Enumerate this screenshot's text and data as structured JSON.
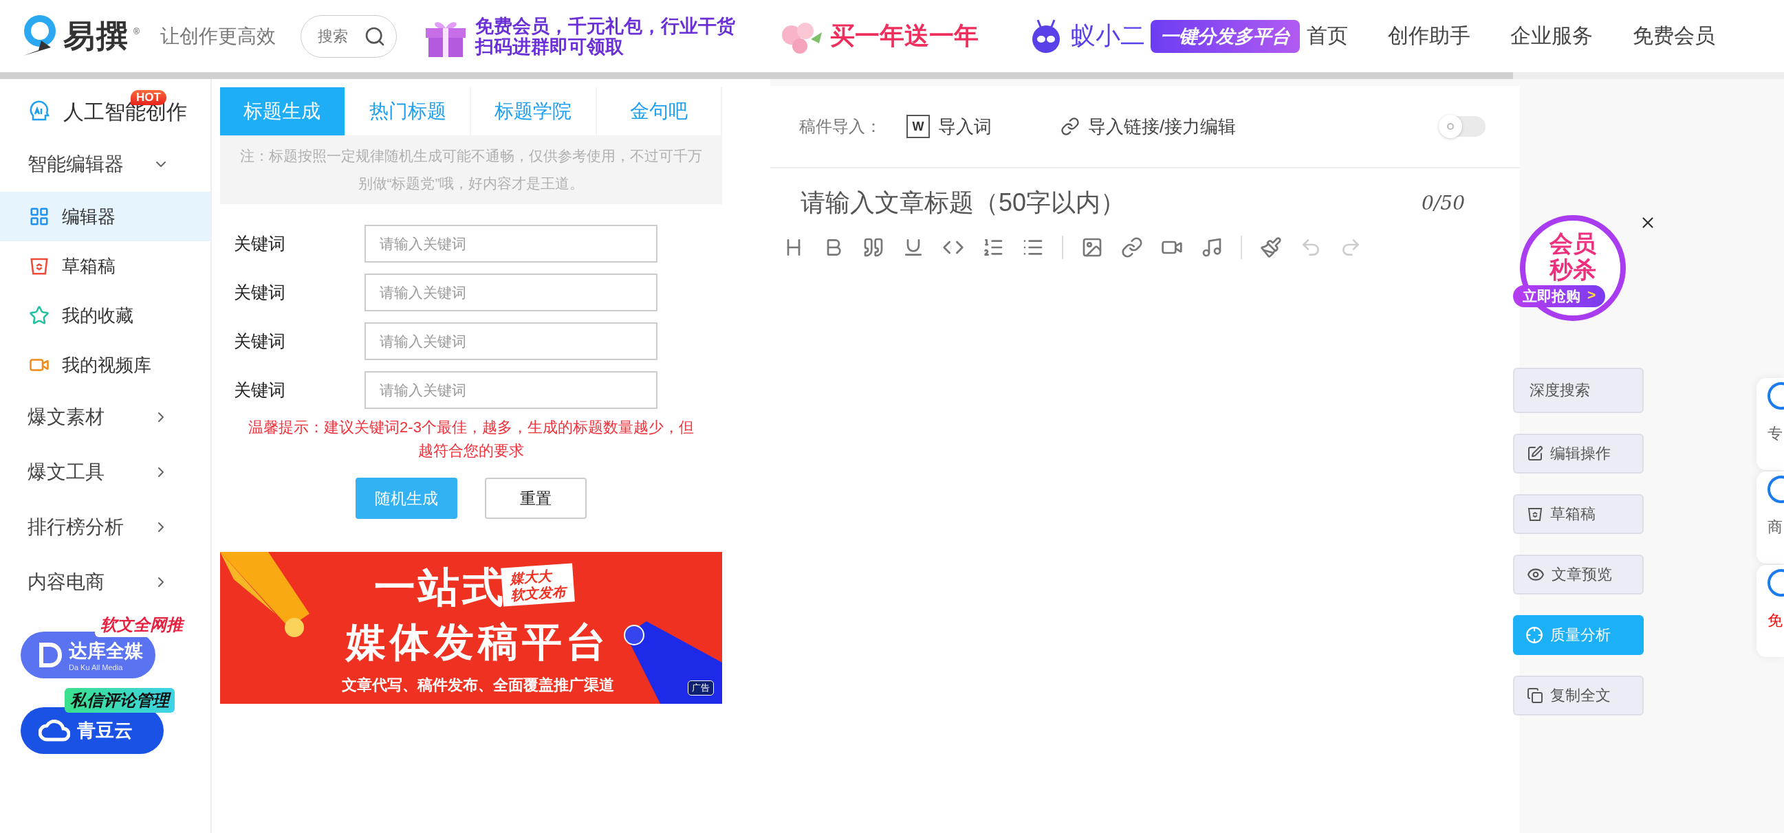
{
  "header": {
    "logo": "易撰",
    "registered": "®",
    "slogan": "让创作更高效",
    "search": {
      "placeholder": "搜索"
    },
    "promos": [
      {
        "kind": "gift",
        "lines": [
          "免费会员，千元礼包，行业干货",
          "扫码进群即可领取"
        ]
      },
      {
        "kind": "flower",
        "lines": [
          "买一年送一年"
        ]
      }
    ],
    "partner": {
      "name": "蚁小二",
      "tag": "一键分发多平台"
    },
    "nav": [
      "首页",
      "创作助手",
      "企业服务",
      "免费会员"
    ]
  },
  "sidebar": {
    "items": [
      {
        "kind": "ai",
        "label": "人工智能创作",
        "badge": "HOT"
      },
      {
        "kind": "group",
        "label": "智能编辑器",
        "expanded": true,
        "children": [
          {
            "label": "编辑器",
            "selected": true
          },
          {
            "label": "草箱稿",
            "selected": false
          },
          {
            "label": "我的收藏",
            "selected": false
          },
          {
            "label": "我的视频库",
            "selected": false
          }
        ]
      },
      {
        "kind": "group",
        "label": "爆文素材",
        "expanded": false
      },
      {
        "kind": "group",
        "label": "爆文工具",
        "expanded": false
      },
      {
        "kind": "group",
        "label": "排行榜分析",
        "expanded": false
      },
      {
        "kind": "group",
        "label": "内容电商",
        "expanded": false
      }
    ],
    "ads": [
      {
        "kind": "daku",
        "name": "达库全媒",
        "subtitle": "Da Ku All Media",
        "tag": "软文全网推"
      },
      {
        "kind": "qingdou",
        "name": "青豆云",
        "tag": "私信评论管理"
      }
    ]
  },
  "title_panel": {
    "tabs": [
      {
        "label": "标题生成",
        "selected": true
      },
      {
        "label": "热门标题",
        "selected": false
      },
      {
        "label": "标题学院",
        "selected": false
      },
      {
        "label": "金句吧",
        "selected": false
      }
    ],
    "note": "注：标题按照一定规律随机生成可能不通畅，仅供参考使用，不过可千万别做“标题党”哦，好内容才是王道。",
    "fields": [
      {
        "label": "关键词",
        "placeholder": "请输入关键词"
      },
      {
        "label": "关键词",
        "placeholder": "请输入关键词"
      },
      {
        "label": "关键词",
        "placeholder": "请输入关键词"
      },
      {
        "label": "关键词",
        "placeholder": "请输入关键词"
      }
    ],
    "tip": "温馨提示：建议关键词2-3个最佳，越多，生成的标题数量越少，但越符合您的要求",
    "buttons": [
      {
        "label": "随机生成",
        "kind": "primary"
      },
      {
        "label": "重置",
        "kind": "default"
      }
    ],
    "ad": {
      "headline": "一站式",
      "subline": "媒体发稿平台",
      "tag_lines": [
        "媒大大",
        "软文发布"
      ],
      "caption": "文章代写、稿件发布、全面覆盖推广渠道",
      "marker": "广告"
    }
  },
  "editor": {
    "import_label": "稿件导入：",
    "word_icon": "W",
    "import_word": "导入词",
    "import_link": "导入链接/接力编辑",
    "sync_toggle": {
      "on": false
    },
    "title_placeholder": "请输入文章标题（50字以内）",
    "counter": "0/50"
  },
  "promo": {
    "lines": [
      "会员",
      "秒杀"
    ],
    "action": "立即抢购",
    "arrow": ">"
  },
  "side_buttons": [
    {
      "label": "深度搜索",
      "selected": false
    },
    {
      "label": "编辑操作",
      "selected": false
    },
    {
      "label": "草箱稿",
      "selected": false
    },
    {
      "label": "文章预览",
      "selected": false
    },
    {
      "label": "质量分析",
      "selected": true
    },
    {
      "label": "复制全文",
      "selected": false
    }
  ],
  "float_cards": [
    {
      "label": "专",
      "kind": "normal"
    },
    {
      "label": "商",
      "kind": "normal"
    },
    {
      "label": "免",
      "kind": "alert"
    }
  ]
}
